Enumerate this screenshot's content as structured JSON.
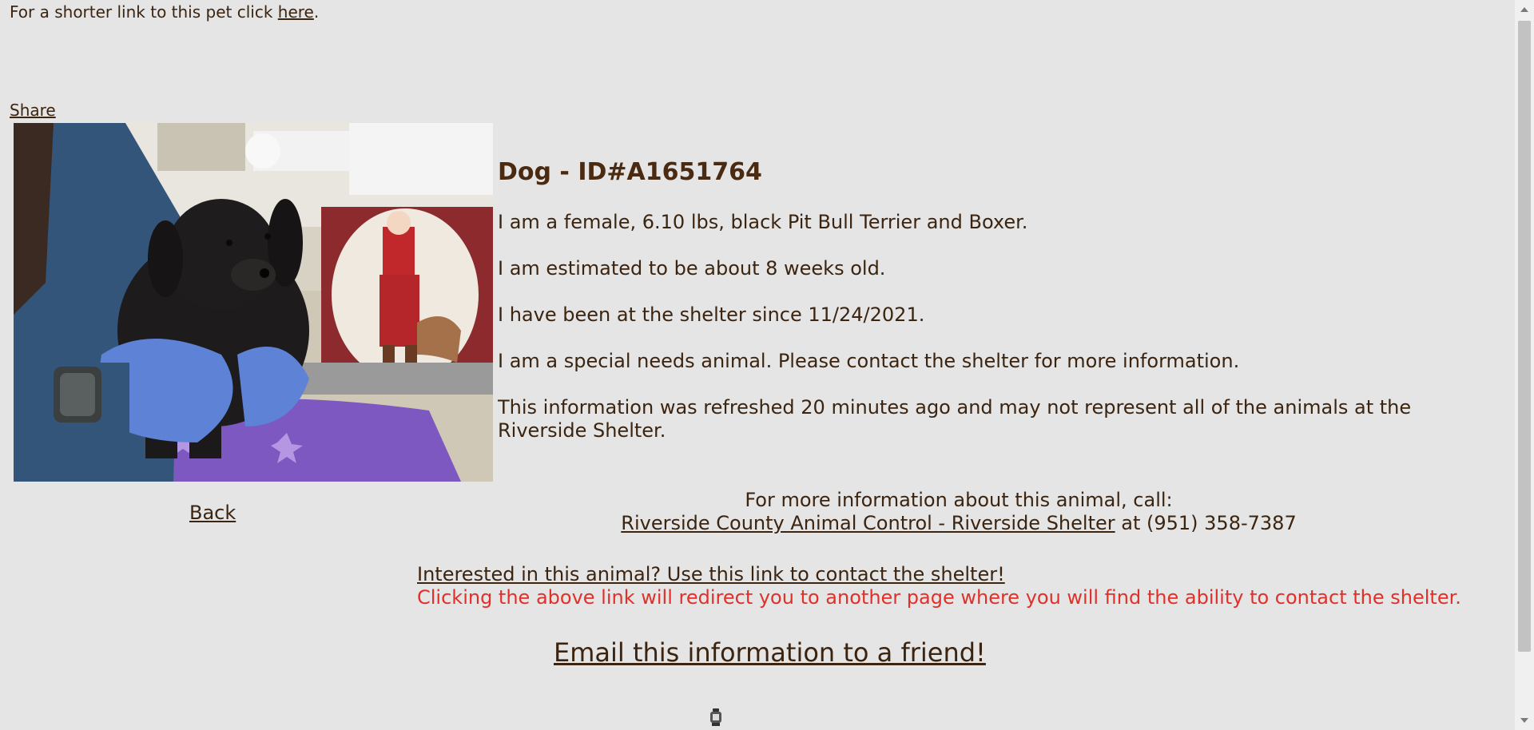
{
  "header": {
    "short_link_prefix": "For a shorter link to this pet click ",
    "short_link_label": "here",
    "short_link_suffix": ".",
    "share_label": "Share"
  },
  "pet": {
    "title": "Dog - ID#A1651764",
    "photo_icon": "pet-photo",
    "facts": [
      "I am a female, 6.10 lbs, black Pit Bull Terrier and Boxer.",
      "I am estimated to be about 8 weeks old.",
      "I have been at the shelter since 11/24/2021.",
      "I am a special needs animal. Please contact the shelter for more information.",
      "This information was refreshed 20 minutes ago and may not represent all of the animals at the Riverside Shelter."
    ]
  },
  "nav": {
    "back_label": "Back"
  },
  "contact": {
    "intro": "For more information about this animal, call:",
    "shelter_link": "Riverside County Animal Control - Riverside Shelter",
    "phone_text": " at (951) 358-7387"
  },
  "interest": {
    "link_label": "Interested in this animal? Use this link to contact the shelter!",
    "note": "Clicking the above link will redirect you to another page where you will find the ability to contact the shelter."
  },
  "email": {
    "label": "Email this information to a friend!"
  },
  "colors": {
    "background": "#e5e5e5",
    "text": "#3b2410",
    "warning": "#e0302a"
  }
}
